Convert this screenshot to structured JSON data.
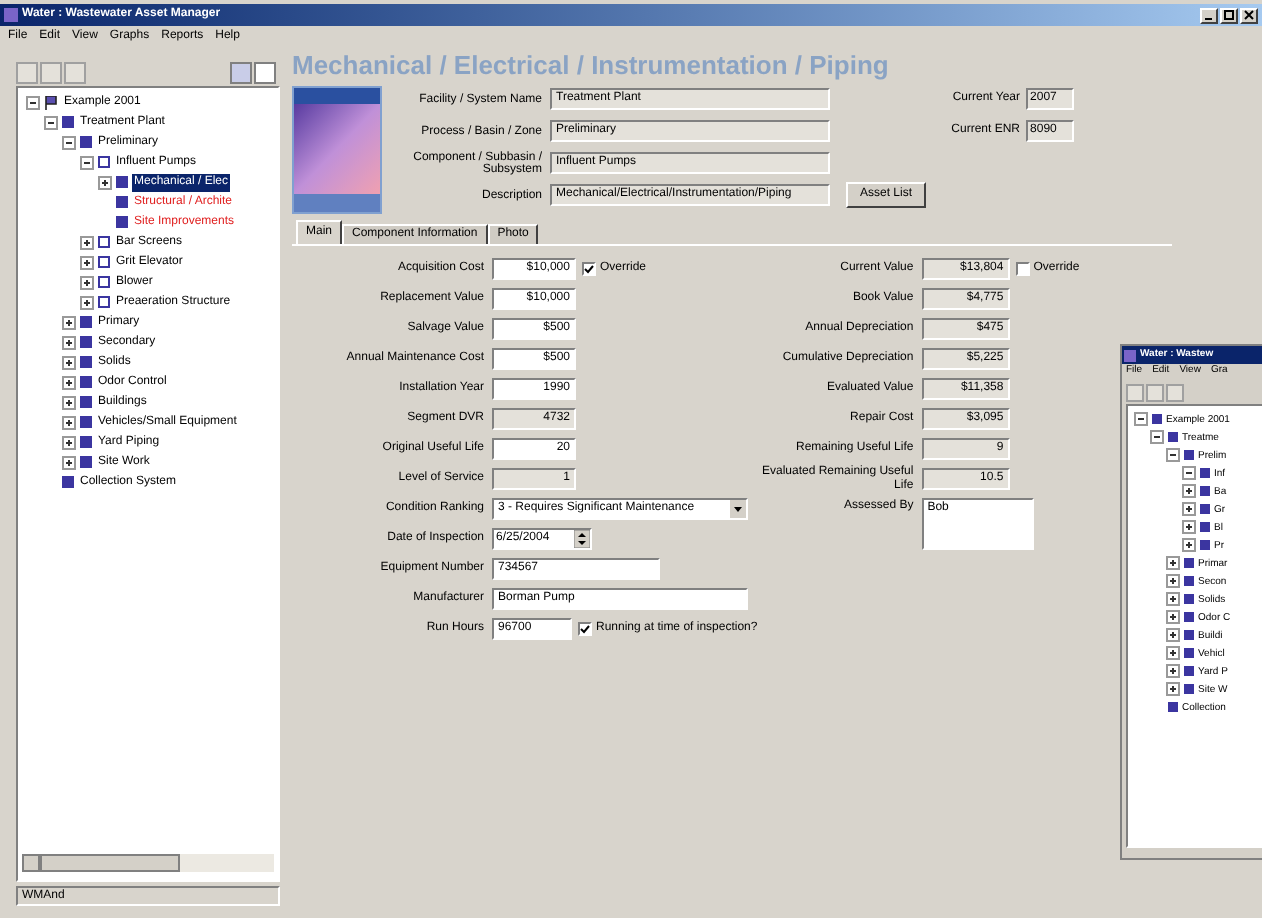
{
  "window": {
    "title": "Water : Wastewater Asset Manager"
  },
  "menu": [
    "File",
    "Edit",
    "View",
    "Graphs",
    "Reports",
    "Help"
  ],
  "tree": [
    {
      "label": "Example 2001",
      "kind": "root",
      "expanded": true,
      "selected": false,
      "flagged": false,
      "children": [
        {
          "label": "Treatment Plant",
          "kind": "facility",
          "expanded": true,
          "selected": false,
          "flagged": false,
          "children": [
            {
              "label": "Preliminary",
              "kind": "facility",
              "expanded": true,
              "selected": false,
              "flagged": false,
              "children": [
                {
                  "label": "Influent Pumps",
                  "kind": "subsystem",
                  "expanded": true,
                  "selected": false,
                  "flagged": false,
                  "children": [
                    {
                      "label": "Mechanical / Elec",
                      "kind": "facility",
                      "expanded": false,
                      "selected": true,
                      "flagged": false
                    },
                    {
                      "label": "Structural / Archite",
                      "kind": "facility",
                      "selected": false,
                      "flagged": true
                    },
                    {
                      "label": "Site Improvements",
                      "kind": "facility",
                      "selected": false,
                      "flagged": true
                    }
                  ]
                },
                {
                  "label": "Bar Screens",
                  "kind": "subsystem",
                  "expanded": false,
                  "selected": false,
                  "flagged": false
                },
                {
                  "label": "Grit Elevator",
                  "kind": "subsystem",
                  "expanded": false,
                  "selected": false,
                  "flagged": false
                },
                {
                  "label": "Blower",
                  "kind": "subsystem",
                  "expanded": false,
                  "selected": false,
                  "flagged": false
                },
                {
                  "label": "Preaeration Structure",
                  "kind": "subsystem",
                  "expanded": false,
                  "selected": false,
                  "flagged": false
                }
              ]
            },
            {
              "label": "Primary",
              "kind": "facility",
              "expanded": false,
              "selected": false,
              "flagged": false
            },
            {
              "label": "Secondary",
              "kind": "facility",
              "expanded": false,
              "selected": false,
              "flagged": false
            },
            {
              "label": "Solids",
              "kind": "facility",
              "expanded": false,
              "selected": false,
              "flagged": false
            },
            {
              "label": "Odor Control",
              "kind": "facility",
              "expanded": false,
              "selected": false,
              "flagged": false
            },
            {
              "label": "Buildings",
              "kind": "facility",
              "expanded": false,
              "selected": false,
              "flagged": false
            },
            {
              "label": "Vehicles/Small Equipment",
              "kind": "facility",
              "expanded": false,
              "selected": false,
              "flagged": false
            },
            {
              "label": "Yard Piping",
              "kind": "facility",
              "expanded": false,
              "selected": false,
              "flagged": false
            },
            {
              "label": "Site Work",
              "kind": "facility",
              "expanded": false,
              "selected": false,
              "flagged": false
            }
          ]
        },
        {
          "label": "Collection System",
          "kind": "facility",
          "selected": false,
          "flagged": false
        }
      ]
    }
  ],
  "status_bar": "WMAnd",
  "page_title": "Mechanical / Electrical / Instrumentation / Piping",
  "header_fields": [
    {
      "label": "Facility / System Name",
      "value": "Treatment Plant"
    },
    {
      "label": "Process / Basin / Zone",
      "value": "Preliminary"
    },
    {
      "label": "Component / Subbasin / Subsystem",
      "value": "Influent Pumps"
    },
    {
      "label": "Description",
      "value": "Mechanical/Electrical/Instrumentation/Piping"
    }
  ],
  "header_right": [
    {
      "label": "Current Year",
      "value": "2007"
    },
    {
      "label": "Current ENR",
      "value": "8090"
    }
  ],
  "asset_list_button": "Asset List",
  "tabs": [
    {
      "label": "Main",
      "selected": true
    },
    {
      "label": "Component Information",
      "selected": false
    },
    {
      "label": "Photo",
      "selected": false
    }
  ],
  "left_fields": [
    {
      "kind": "number",
      "label": "Acquisition Cost",
      "value": "$10,000",
      "disabled": false,
      "checkbox": {
        "label": "Override",
        "checked": true
      }
    },
    {
      "kind": "number",
      "label": "Replacement Value",
      "value": "$10,000",
      "disabled": false
    },
    {
      "kind": "number",
      "label": "Salvage Value",
      "value": "$500",
      "disabled": false
    },
    {
      "kind": "number",
      "label": "Annual Maintenance Cost",
      "value": "$500",
      "disabled": false
    },
    {
      "kind": "number",
      "label": "Installation Year",
      "value": "1990",
      "disabled": false
    },
    {
      "kind": "number",
      "label": "Segment DVR",
      "value": "4732",
      "disabled": true
    },
    {
      "kind": "number",
      "label": "Original Useful Life",
      "value": "20",
      "disabled": false
    },
    {
      "kind": "number",
      "label": "Level of Service",
      "value": "1",
      "disabled": true
    },
    {
      "kind": "dropdown",
      "label": "Condition Ranking",
      "value": "3 - Requires Significant Maintenance",
      "disabled": false
    },
    {
      "kind": "date",
      "label": "Date of Inspection",
      "value": "6/25/2004",
      "disabled": false
    },
    {
      "kind": "text",
      "label": "Equipment Number",
      "value": "734567",
      "disabled": false
    },
    {
      "kind": "wide",
      "label": "Manufacturer",
      "value": "Borman Pump",
      "disabled": false
    },
    {
      "kind": "short",
      "label": "Run Hours",
      "value": "96700",
      "disabled": false,
      "checkbox": {
        "label": "Running at time of inspection?",
        "checked": true
      }
    }
  ],
  "right_fields": [
    {
      "kind": "number",
      "label": "Current Value",
      "value": "$13,804",
      "checkbox": {
        "label": "Override",
        "checked": false
      }
    },
    {
      "kind": "number",
      "label": "Book Value",
      "value": "$4,775"
    },
    {
      "kind": "number",
      "label": "Annual Depreciation",
      "value": "$475"
    },
    {
      "kind": "number",
      "label": "Cumulative Depreciation",
      "value": "$5,225"
    },
    {
      "kind": "number",
      "label": "Evaluated Value",
      "value": "$11,358"
    },
    {
      "kind": "number",
      "label": "Repair Cost",
      "value": "$3,095"
    },
    {
      "kind": "number",
      "label": "Remaining Useful Life",
      "value": "9"
    },
    {
      "kind": "number",
      "label": "Evaluated Remaining Useful Life",
      "value": "10.5"
    },
    {
      "kind": "memo",
      "label": "Assessed By",
      "value": "Bob"
    }
  ],
  "second_window": {
    "title": "Water : Wastew",
    "menu": [
      "File",
      "Edit",
      "View",
      "Gra"
    ],
    "tree": [
      {
        "label": "Example 2001",
        "expanded": true,
        "children": [
          {
            "label": "Treatme",
            "expanded": true,
            "children": [
              {
                "label": "Prelim",
                "expanded": true,
                "children": [
                  {
                    "label": "Inf",
                    "expanded": true
                  },
                  {
                    "label": "Ba",
                    "expanded": false
                  },
                  {
                    "label": "Gr",
                    "expanded": false
                  },
                  {
                    "label": "Bl",
                    "expanded": false
                  },
                  {
                    "label": "Pr",
                    "expanded": false
                  }
                ]
              },
              {
                "label": "Primar",
                "expanded": false
              },
              {
                "label": "Secon",
                "expanded": false
              },
              {
                "label": "Solids",
                "expanded": false
              },
              {
                "label": "Odor C",
                "expanded": false
              },
              {
                "label": "Buildi",
                "expanded": false
              },
              {
                "label": "Vehicl",
                "expanded": false
              },
              {
                "label": "Yard P",
                "expanded": false
              },
              {
                "label": "Site W",
                "expanded": false
              }
            ]
          },
          {
            "label": "Collection"
          }
        ]
      }
    ]
  }
}
